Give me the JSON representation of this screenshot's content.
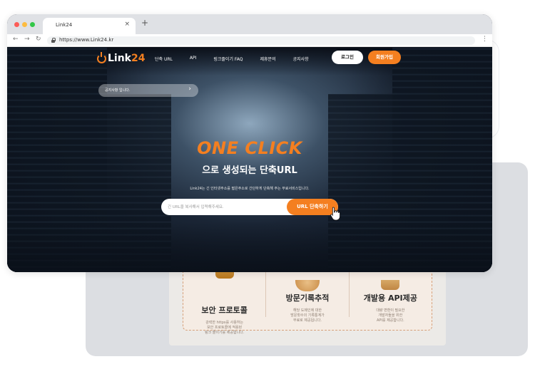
{
  "browser": {
    "tab_title": "Link24",
    "tab_close": "×",
    "new_tab": "+",
    "url": "https://www.Link24.kr"
  },
  "site": {
    "logo_prefix": "Link",
    "logo_accent": "24",
    "nav": [
      "단축 URL",
      "API",
      "링크줄이기 FAQ",
      "제휴문의",
      "공지사항"
    ],
    "login_label": "로그인",
    "signup_label": "회원가입",
    "notice_text": "공지사항 입니다.",
    "headline": "ONE CLICK",
    "subheadline": "으로 생성되는 단축URL",
    "description": "Link24는 긴 인터넷주소를 짧은주소로 간단하게 단축해 주는 무료서비스입니다.",
    "search_placeholder": "긴 URL을 복사해서 입력해주세요.",
    "search_button": "URL 단축하기"
  },
  "features": [
    {
      "title": "보안 프로토콜",
      "desc": "강력한 https를 사용하는\n보안 프로토콜에 적용된\n링크 줄이기를 제공합니다."
    },
    {
      "title": "방문기록추적",
      "desc": "해당 도메인에 대한\n방문횟수의 기록통계가\n무료로 제공됩니다."
    },
    {
      "title": "개발용 API제공",
      "desc": "대량 변환이 필요한\n개발자들을 위한\nAPI를 제공합니다."
    }
  ],
  "colors": {
    "accent": "#f47f20",
    "tabbar": "#dfe1e5"
  }
}
